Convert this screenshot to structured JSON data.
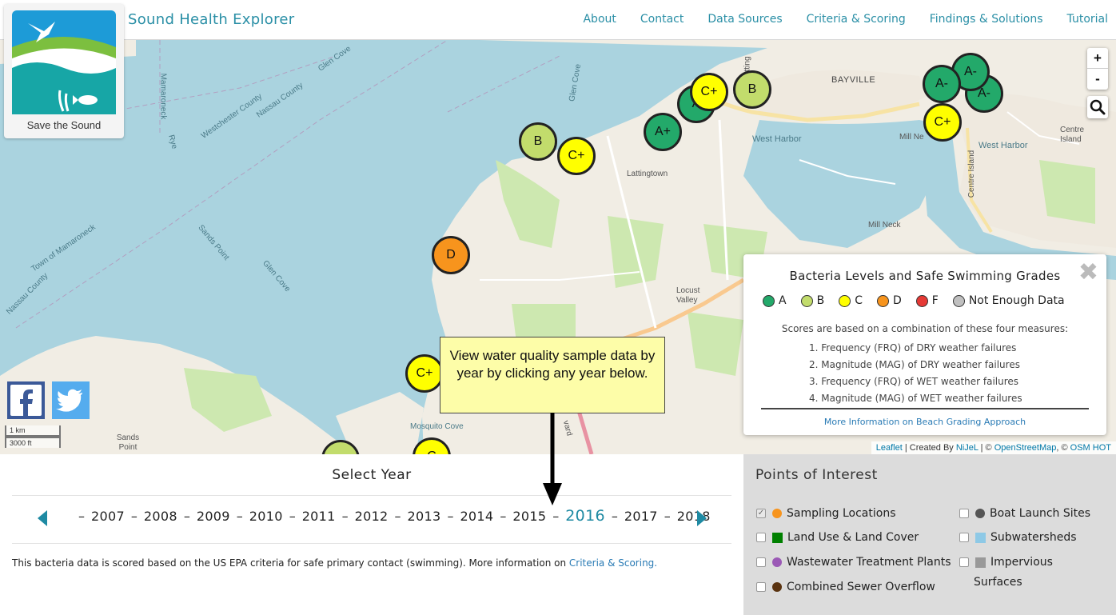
{
  "header": {
    "title": "Sound Health Explorer",
    "nav": [
      "About",
      "Contact",
      "Data Sources",
      "Criteria & Scoring",
      "Findings & Solutions",
      "Tutorial"
    ]
  },
  "logo": {
    "text": "Save the Sound"
  },
  "map": {
    "places": {
      "glen_cove_1": "Glen Cove",
      "mamaroneck": "Mamaroneck",
      "westchester": "Westchester County",
      "nassau_1": "Nassau County",
      "rye": "Rye",
      "glen_cove_2": "Glen Cove",
      "lattingtown": "Lattingtown",
      "bayville": "BAYVILLE",
      "west_harbor_1": "West Harbor",
      "west_harbor_2": "West Harbor",
      "centre_island_1": "Centre Island",
      "centre_island_2": "Centre Island",
      "mill_neck_1": "Mill Neck",
      "mill_neck_2": "Mill Ne",
      "town_mamaroneck": "Town of Mamaroneck",
      "sands_point_1": "Sands Point",
      "glen_cove_3": "Glen Cove",
      "nassau_2": "Nassau County",
      "locust_valley": "Locust Valley",
      "mosquito_cove": "Mosquito Cove",
      "sands_point_2": "Sands Point",
      "latting": "Latting",
      "boulevard": "vard"
    },
    "markers": [
      {
        "id": "m1",
        "grade": "B",
        "color": "#c2dc6c"
      },
      {
        "id": "m2",
        "grade": "C+",
        "color": "#ffff00"
      },
      {
        "id": "m3",
        "grade": "A+",
        "color": "#23a96a"
      },
      {
        "id": "m4",
        "grade": "A",
        "color": "#23a96a"
      },
      {
        "id": "m5",
        "grade": "C+",
        "color": "#ffff00"
      },
      {
        "id": "m6",
        "grade": "B",
        "color": "#c2dc6c"
      },
      {
        "id": "m7",
        "grade": "A-",
        "color": "#23a96a"
      },
      {
        "id": "m8",
        "grade": "A-",
        "color": "#23a96a"
      },
      {
        "id": "m9",
        "grade": "A-",
        "color": "#23a96a"
      },
      {
        "id": "m10",
        "grade": "C+",
        "color": "#ffff00"
      },
      {
        "id": "m11",
        "grade": "D",
        "color": "#f7941d"
      },
      {
        "id": "m12",
        "grade": "C+",
        "color": "#ffff00"
      },
      {
        "id": "m13",
        "grade": "",
        "color": "#c2dc6c"
      },
      {
        "id": "m14",
        "grade": "C",
        "color": "#ffff00"
      }
    ],
    "zoom_in": "+",
    "zoom_out": "-",
    "scale_km": "1 km",
    "scale_ft": "3000 ft",
    "attribution": {
      "leaflet": "Leaflet",
      "created_by": " | Created By ",
      "nijel": "NiJeL",
      "sep": " | © ",
      "osm": "OpenStreetMap",
      "sep2": ", © ",
      "hot": "OSM HOT"
    }
  },
  "legend": {
    "title": "Bacteria Levels and Safe Swimming Grades",
    "close": "✖",
    "keys": [
      {
        "label": "A",
        "color": "#23a96a"
      },
      {
        "label": "B",
        "color": "#c2dc6c"
      },
      {
        "label": "C",
        "color": "#ffff00"
      },
      {
        "label": "D",
        "color": "#f7941d"
      },
      {
        "label": "F",
        "color": "#e53935"
      },
      {
        "label": "Not Enough Data",
        "color": "#c0c0c0"
      }
    ],
    "intro": "Scores are based on a combination of these four measures:",
    "measures": [
      "1. Frequency (FRQ) of DRY weather failures",
      "2. Magnitude (MAG) of DRY weather failures",
      "3. Frequency (FRQ) of WET weather failures",
      "4. Magnitude (MAG) of WET weather failures"
    ],
    "more_link": "More Information on Beach Grading Approach"
  },
  "callout": {
    "text": "View water quality sample data by year by clicking any year below."
  },
  "year_panel": {
    "title": "Select Year",
    "years": [
      "2007",
      "2008",
      "2009",
      "2010",
      "2011",
      "2012",
      "2013",
      "2014",
      "2015",
      "2016",
      "2017",
      "2018"
    ],
    "selected": "2016",
    "footnote": "This bacteria data is scored based on the US EPA criteria for safe primary contact (swimming). More information on ",
    "footnote_link": "Criteria & Scoring."
  },
  "poi": {
    "title": "Points of Interest",
    "items": [
      {
        "label": "Sampling Locations",
        "checked": true,
        "swatch": "dot",
        "color": "#f7941d"
      },
      {
        "label": "Land Use & Land Cover",
        "checked": false,
        "swatch": "sq",
        "color": "#008000"
      },
      {
        "label": "Wastewater Treatment Plants",
        "checked": false,
        "swatch": "dot",
        "color": "#9b59b6"
      },
      {
        "label": "Combined Sewer Overflow",
        "checked": false,
        "swatch": "dot",
        "color": "#5a3310"
      },
      {
        "label": "Boat Launch Sites",
        "checked": false,
        "swatch": "dot",
        "color": "#555555"
      },
      {
        "label": "Subwatersheds",
        "checked": false,
        "swatch": "sq",
        "color": "#8ec9e6"
      },
      {
        "label": "Impervious",
        "checked": false,
        "swatch": "sq",
        "color": "#999999"
      }
    ],
    "impervious_line2": "Surfaces"
  }
}
